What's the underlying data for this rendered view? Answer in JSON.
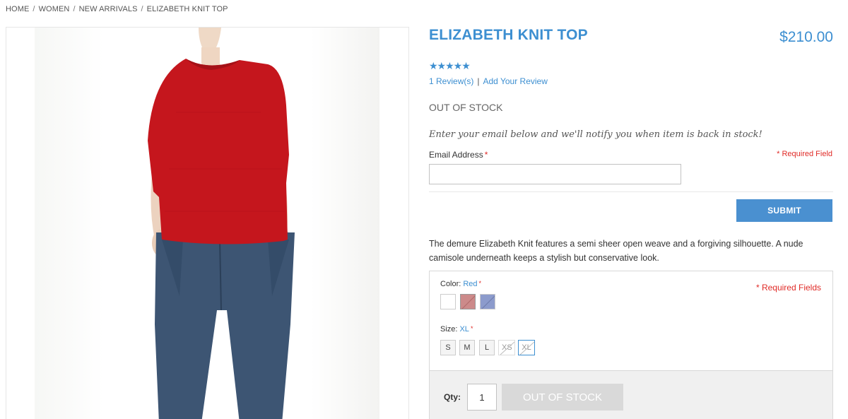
{
  "breadcrumb": {
    "items": [
      "HOME",
      "WOMEN",
      "NEW ARRIVALS",
      "ELIZABETH KNIT TOP"
    ],
    "separator": "/"
  },
  "product": {
    "title": "ELIZABETH KNIT TOP",
    "price": "$210.00",
    "rating_stars": "★★★★★",
    "rating_value": 5,
    "reviews_link": "1 Review(s)",
    "review_separator": "|",
    "add_review_link": "Add Your Review",
    "stock_status": "OUT OF STOCK",
    "description": "The demure Elizabeth Knit features a semi sheer open weave and a forgiving silhouette. A nude camisole underneath keeps a stylish but conservative look."
  },
  "notify_form": {
    "prompt": "Enter your email below and we'll notify you when item is back in stock!",
    "email_label": "Email Address",
    "required_star": "*",
    "required_note": "* Required Field",
    "email_value": "",
    "submit_label": "SUBMIT"
  },
  "options": {
    "required_note": "* Required Fields",
    "color": {
      "label": "Color:",
      "selected": "Red",
      "swatches": [
        {
          "name": "White",
          "hex": "#ffffff",
          "available": true
        },
        {
          "name": "Red",
          "hex": "#cc8a8a",
          "available": false
        },
        {
          "name": "Blue",
          "hex": "#8c9bcc",
          "available": false
        }
      ]
    },
    "size": {
      "label": "Size:",
      "selected": "XL",
      "values": [
        "S",
        "M",
        "L",
        "XS",
        "XL"
      ]
    }
  },
  "cart": {
    "qty_label": "Qty:",
    "qty_value": "1",
    "button_label": "OUT OF STOCK"
  },
  "colors": {
    "accent": "#3d8fd1",
    "required": "#e02b27",
    "submit_bg": "#4a90d0",
    "disabled_button": "#d9d9d9"
  }
}
